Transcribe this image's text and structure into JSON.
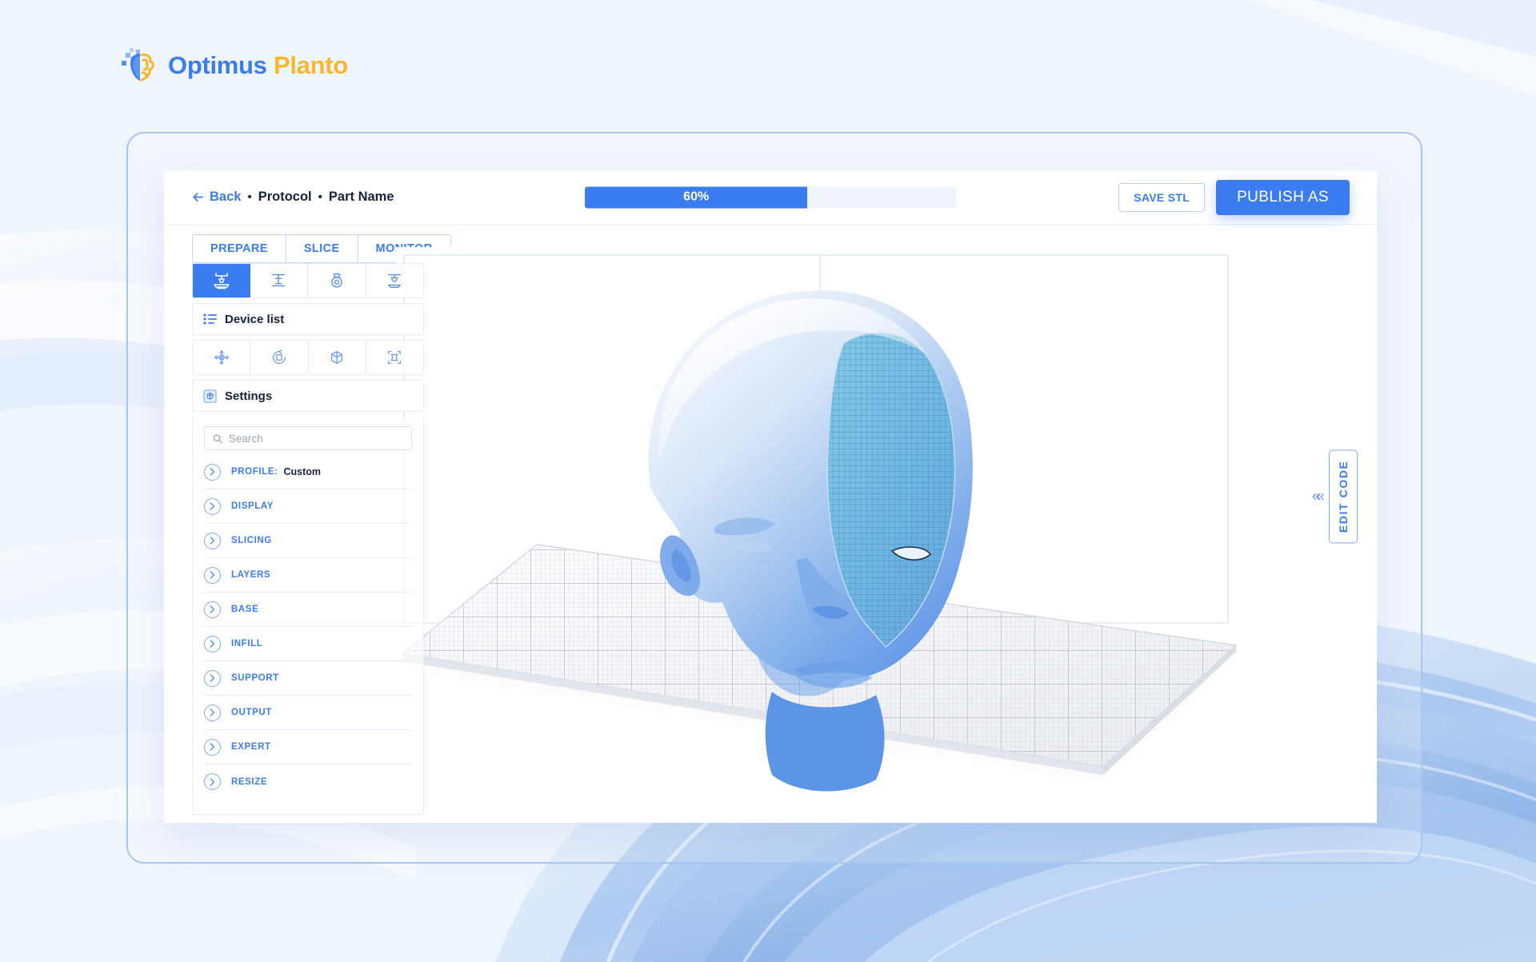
{
  "brand": {
    "name_primary": "Optimus",
    "name_secondary": "Planto",
    "color_primary": "#3b7cf0",
    "color_secondary": "#f8b62c",
    "logo_icon": "brain-icon"
  },
  "topbar": {
    "back_label": "Back",
    "separator": "•",
    "breadcrumb_protocol": "Protocol",
    "breadcrumb_part": "Part Name",
    "progress": {
      "percent": 60,
      "label": "60%",
      "fill_color": "#3b7cf0",
      "track_color": "#f0f5fd"
    },
    "save_label": "SAVE STL",
    "publish_label": "PUBLISH AS"
  },
  "tabs": [
    {
      "label": "PREPARE",
      "active": false
    },
    {
      "label": "SLICE",
      "active": false
    },
    {
      "label": "MONITOR",
      "active": false
    }
  ],
  "device_toolbar": [
    {
      "icon": "printer-nozzle-icon",
      "active": true
    },
    {
      "icon": "printer-bed-icon",
      "active": false
    },
    {
      "icon": "filament-spool-icon",
      "active": false
    },
    {
      "icon": "printer-extruder-icon",
      "active": false
    }
  ],
  "device_list": {
    "label": "Device list",
    "icon": "list-icon"
  },
  "transform_toolbar": [
    {
      "icon": "move-icon"
    },
    {
      "icon": "rotate-icon"
    },
    {
      "icon": "scale-cube-icon"
    },
    {
      "icon": "bounding-box-icon"
    }
  ],
  "settings": {
    "title": "Settings",
    "icon": "settings-box-icon",
    "search_placeholder": "Search",
    "search_value": "",
    "rows": [
      {
        "label": "PROFILE:",
        "value": "Custom"
      },
      {
        "label": "DISPLAY",
        "value": ""
      },
      {
        "label": "SLICING",
        "value": ""
      },
      {
        "label": "LAYERS",
        "value": ""
      },
      {
        "label": "BASE",
        "value": ""
      },
      {
        "label": "INFILL",
        "value": ""
      },
      {
        "label": "SUPPORT",
        "value": ""
      },
      {
        "label": "OUTPUT",
        "value": ""
      },
      {
        "label": "EXPERT",
        "value": ""
      },
      {
        "label": "RESIZE",
        "value": ""
      }
    ]
  },
  "viewport": {
    "model": "human-head-3d-model",
    "model_shading": "smooth-and-wireframe",
    "build_plate": "grid-build-plate",
    "build_volume": "wireframe-box"
  },
  "edit_code": {
    "label": "EDIT CODE",
    "collapse_icon": "chevron-double-left-icon"
  }
}
